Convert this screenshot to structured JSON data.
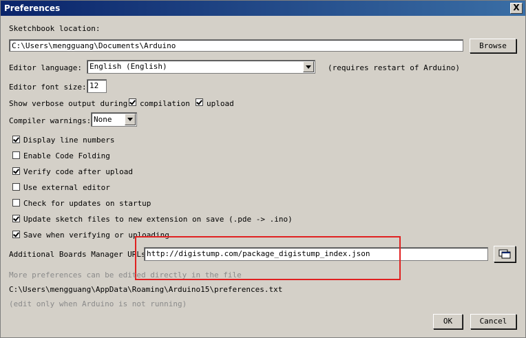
{
  "window": {
    "title": "Preferences",
    "close_label": "X"
  },
  "sketchbook": {
    "label": "Sketchbook location:",
    "path": "C:\\Users\\mengguang\\Documents\\Arduino",
    "browse": "Browse"
  },
  "language": {
    "label": "Editor language:",
    "value": "English (English)",
    "note": "(requires restart of Arduino)"
  },
  "font_size": {
    "label": "Editor font size:",
    "value": "12"
  },
  "verbose": {
    "label": "Show verbose output during:",
    "compilation": "compilation",
    "upload": "upload"
  },
  "warnings": {
    "label": "Compiler warnings:",
    "value": "None"
  },
  "options": [
    {
      "label": "Display line numbers",
      "checked": true
    },
    {
      "label": "Enable Code Folding",
      "checked": false
    },
    {
      "label": "Verify code after upload",
      "checked": true
    },
    {
      "label": "Use external editor",
      "checked": false
    },
    {
      "label": "Check for updates on startup",
      "checked": false
    },
    {
      "label": "Update sketch files to new extension on save (.pde -> .ino)",
      "checked": true
    },
    {
      "label": "Save when verifying or uploading",
      "checked": true
    }
  ],
  "boards": {
    "label": "Additional Boards Manager URLs",
    "value": "http://digistump.com/package_digistump_index.json"
  },
  "footer": {
    "more_note": "More preferences can be edited directly in the file",
    "prefs_path": "C:\\Users\\mengguang\\AppData\\Roaming\\Arduino15\\preferences.txt",
    "edit_note": "(edit only when Arduino is not running)"
  },
  "buttons": {
    "ok": "OK",
    "cancel": "Cancel"
  },
  "colors": {
    "highlight_box": "#e02020",
    "title_bar": "#0a246a"
  }
}
